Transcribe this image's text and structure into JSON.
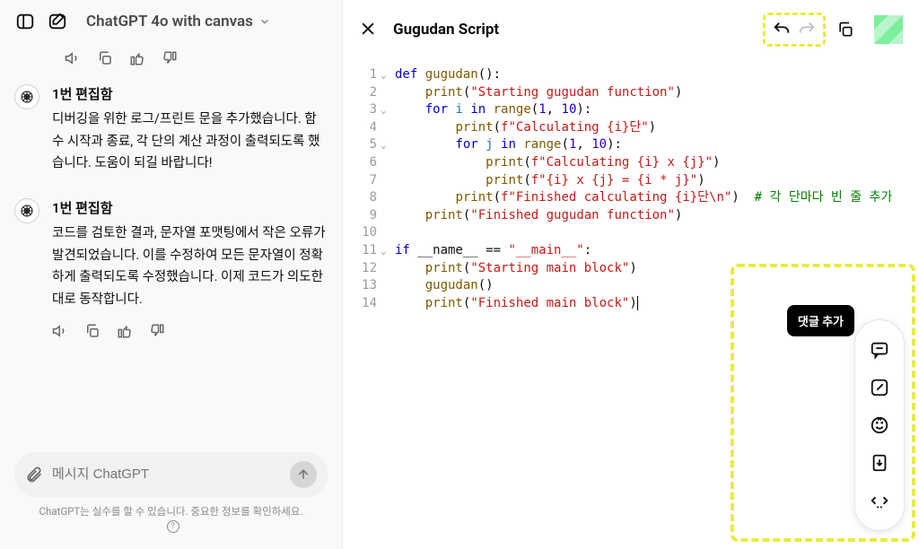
{
  "header": {
    "model_label": "ChatGPT 4o with canvas"
  },
  "messages": [
    {
      "title": "1번 편집함",
      "body": "디버깅을 위한 로그/프린트 문을 추가했습니다. 함수 시작과 종료, 각 단의 계산 과정이 출력되도록 했습니다. 도움이 되길 바랍니다!"
    },
    {
      "title": "1번 편집함",
      "body": "코드를 검토한 결과, 문자열 포맷팅에서 작은 오류가 발견되었습니다. 이를 수정하여 모든 문자열이 정확하게 출력되도록 수정했습니다. 이제 코드가 의도한 대로 동작합니다."
    }
  ],
  "composer": {
    "placeholder": "메시지 ChatGPT",
    "disclaimer": "ChatGPT는 실수를 할 수 있습니다. 중요한 정보를 확인하세요."
  },
  "canvas": {
    "title": "Gugudan Script",
    "tooltip": "댓글 추가",
    "code_lines": [
      {
        "n": 1,
        "chev": true,
        "tokens": [
          [
            "kw",
            "def "
          ],
          [
            "fn",
            "gugudan"
          ],
          [
            "",
            "():"
          ]
        ]
      },
      {
        "n": 2,
        "chev": false,
        "tokens": [
          [
            "",
            "    "
          ],
          [
            "fn",
            "print"
          ],
          [
            "",
            "("
          ],
          [
            "str",
            "\"Starting gugudan function\""
          ],
          [
            "",
            ")"
          ]
        ]
      },
      {
        "n": 3,
        "chev": true,
        "tokens": [
          [
            "",
            "    "
          ],
          [
            "kw",
            "for"
          ],
          [
            "",
            " "
          ],
          [
            "var",
            "i"
          ],
          [
            "",
            " "
          ],
          [
            "kw",
            "in"
          ],
          [
            "",
            " "
          ],
          [
            "fn",
            "range"
          ],
          [
            "",
            "("
          ],
          [
            "num",
            "1"
          ],
          [
            "",
            ", "
          ],
          [
            "num",
            "10"
          ],
          [
            "",
            "):"
          ]
        ]
      },
      {
        "n": 4,
        "chev": false,
        "tokens": [
          [
            "",
            "        "
          ],
          [
            "fn",
            "print"
          ],
          [
            "",
            "("
          ],
          [
            "str",
            "f\"Calculating {i}단\""
          ],
          [
            "",
            ")"
          ]
        ]
      },
      {
        "n": 5,
        "chev": true,
        "tokens": [
          [
            "",
            "        "
          ],
          [
            "kw",
            "for"
          ],
          [
            "",
            " "
          ],
          [
            "var",
            "j"
          ],
          [
            "",
            " "
          ],
          [
            "kw",
            "in"
          ],
          [
            "",
            " "
          ],
          [
            "fn",
            "range"
          ],
          [
            "",
            "("
          ],
          [
            "num",
            "1"
          ],
          [
            "",
            ", "
          ],
          [
            "num",
            "10"
          ],
          [
            "",
            "):"
          ]
        ]
      },
      {
        "n": 6,
        "chev": false,
        "tokens": [
          [
            "",
            "            "
          ],
          [
            "fn",
            "print"
          ],
          [
            "",
            "("
          ],
          [
            "str",
            "f\"Calculating {i} x {j}\""
          ],
          [
            "",
            ")"
          ]
        ]
      },
      {
        "n": 7,
        "chev": false,
        "tokens": [
          [
            "",
            "            "
          ],
          [
            "fn",
            "print"
          ],
          [
            "",
            "("
          ],
          [
            "str",
            "f\"{i} x {j} = {i * j}\""
          ],
          [
            "",
            ")"
          ]
        ]
      },
      {
        "n": 8,
        "chev": false,
        "tokens": [
          [
            "",
            "        "
          ],
          [
            "fn",
            "print"
          ],
          [
            "",
            "("
          ],
          [
            "str",
            "f\"Finished calculating {i}단\\n\""
          ],
          [
            "",
            ")  "
          ],
          [
            "cmt",
            "# 각 단마다 빈 줄 추가"
          ]
        ]
      },
      {
        "n": 9,
        "chev": false,
        "tokens": [
          [
            "",
            "    "
          ],
          [
            "fn",
            "print"
          ],
          [
            "",
            "("
          ],
          [
            "str",
            "\"Finished gugudan function\""
          ],
          [
            "",
            ")"
          ]
        ]
      },
      {
        "n": 10,
        "chev": false,
        "tokens": []
      },
      {
        "n": 11,
        "chev": true,
        "tokens": [
          [
            "kw",
            "if"
          ],
          [
            "",
            " __name__ == "
          ],
          [
            "str",
            "\"__main__\""
          ],
          [
            "",
            ":"
          ]
        ]
      },
      {
        "n": 12,
        "chev": false,
        "tokens": [
          [
            "",
            "    "
          ],
          [
            "fn",
            "print"
          ],
          [
            "",
            "("
          ],
          [
            "str",
            "\"Starting main block\""
          ],
          [
            "",
            ")"
          ]
        ]
      },
      {
        "n": 13,
        "chev": false,
        "tokens": [
          [
            "",
            "    "
          ],
          [
            "fn",
            "gugudan"
          ],
          [
            "",
            "()"
          ]
        ]
      },
      {
        "n": 14,
        "chev": false,
        "tokens": [
          [
            "",
            "    "
          ],
          [
            "fn",
            "print"
          ],
          [
            "",
            "("
          ],
          [
            "str",
            "\"Finished main block\""
          ],
          [
            "",
            ")"
          ]
        ]
      }
    ]
  }
}
